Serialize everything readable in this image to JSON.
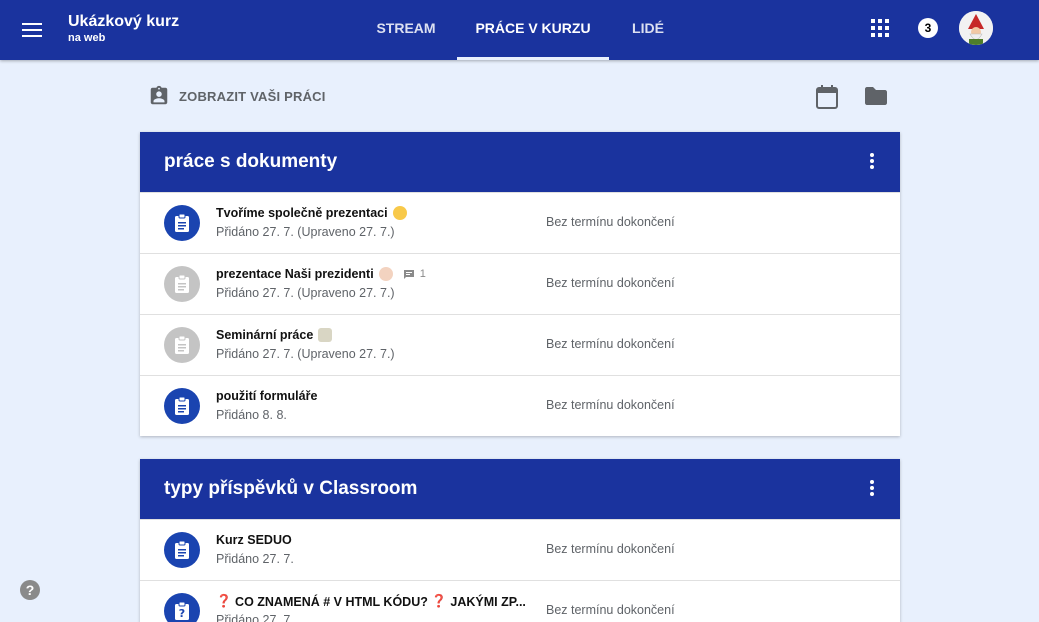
{
  "header": {
    "course_title": "Ukázkový kurz",
    "course_subtitle": "na web",
    "tabs": [
      {
        "label": "STREAM"
      },
      {
        "label": "PRÁCE V KURZU"
      },
      {
        "label": "LIDÉ"
      }
    ],
    "notification_count": "3"
  },
  "toolbar": {
    "view_work_label": "ZOBRAZIT VAŠI PRÁCI"
  },
  "topics": [
    {
      "title": "práce s dokumenty",
      "items": [
        {
          "title": "Tvoříme společně prezentaci",
          "meta": "Přidáno 27. 7. (Upraveno 27. 7.)",
          "due": "Bez termínu dokončení"
        },
        {
          "title": "prezentace Naši prezidenti",
          "comment_count": "1",
          "meta": "Přidáno 27. 7. (Upraveno 27. 7.)",
          "due": "Bez termínu dokončení"
        },
        {
          "title": "Seminární práce",
          "meta": "Přidáno 27. 7. (Upraveno 27. 7.)",
          "due": "Bez termínu dokončení"
        },
        {
          "title": "použití formuláře",
          "meta": "Přidáno 8. 8.",
          "due": "Bez termínu dokončení"
        }
      ]
    },
    {
      "title": "typy příspěvků v Classroom",
      "items": [
        {
          "title": "Kurz SEDUO",
          "meta": "Přidáno 27. 7.",
          "due": "Bez termínu dokončení"
        },
        {
          "title_mark1": "❓",
          "title_part1": " CO ZNAMENÁ # V HTML KÓDU? ",
          "title_mark2": "❓",
          "title_part2": " JAKÝMI ZP...",
          "meta": "Přidáno 27. 7.",
          "due": "Bez termínu dokončení"
        }
      ]
    }
  ],
  "help_label": "?",
  "colors": {
    "header": "#1a339e",
    "background": "#e8f0fd",
    "assignment_icon_active": "#1a44b0",
    "assignment_icon_inactive": "#c4c4c4"
  }
}
